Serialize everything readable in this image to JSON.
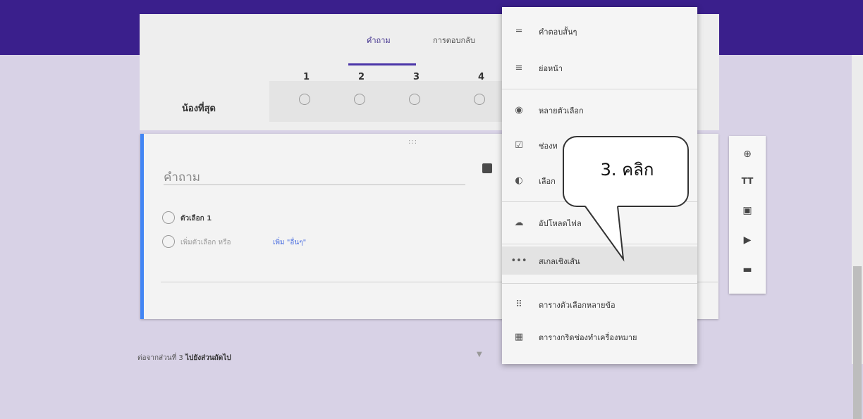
{
  "tabs": {
    "questions": "คำถาม",
    "responses": "การตอบกลับ"
  },
  "scale": {
    "numbers": [
      "1",
      "2",
      "3",
      "4"
    ],
    "row_label": "น้องที่สุด"
  },
  "card": {
    "question_placeholder": "คำถาม",
    "option1": "ตัวเลือก 1",
    "add_option": "เพิ่มตัวเลือก หรือ",
    "add_other": "เพิ่ม \"อื่นๆ\""
  },
  "footer": {
    "after_section": "ต่อจากส่วนที่ 3",
    "go_next": "ไปยังส่วนถัดไป"
  },
  "menu": {
    "items": [
      {
        "label": "คำตอบสั้นๆ",
        "icon": "short-answer-icon"
      },
      {
        "label": "ย่อหน้า",
        "icon": "paragraph-icon"
      },
      {
        "label": "หลายตัวเลือก",
        "icon": "radio-icon"
      },
      {
        "label": "ช่องท",
        "icon": "checkbox-icon"
      },
      {
        "label": "เลือก",
        "icon": "dropdown-icon"
      },
      {
        "label": "อัปโหลดไฟล",
        "icon": "upload-icon"
      },
      {
        "label": "สเกลเชิงเส้น",
        "icon": "linear-scale-icon"
      },
      {
        "label": "ตารางตัวเลือกหลายข้อ",
        "icon": "grid-icon"
      },
      {
        "label": "ตารางกริดช่องทำเครื่องหมาย",
        "icon": "checkbox-grid-icon"
      }
    ]
  },
  "callout": {
    "text": "3. คลิก"
  },
  "colors": {
    "header": "#3a1f8c",
    "accent": "#4285f4",
    "background": "#d8d2e6"
  }
}
